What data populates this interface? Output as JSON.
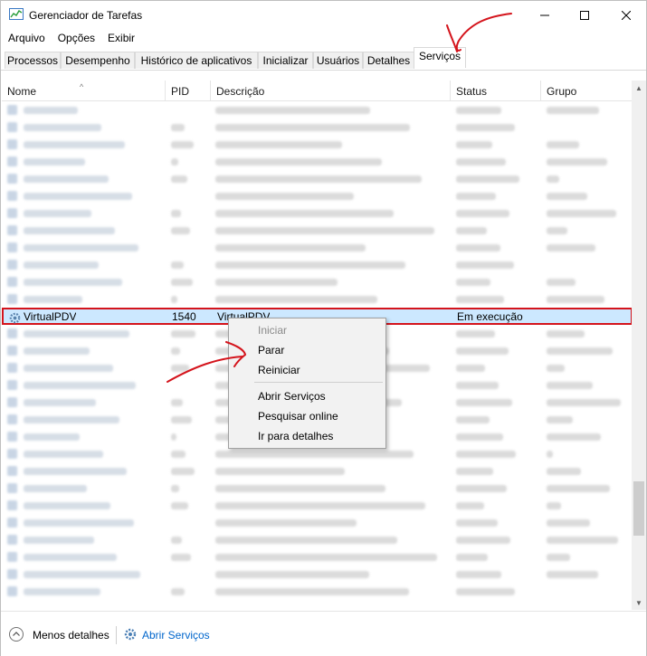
{
  "window": {
    "title": "Gerenciador de Tarefas"
  },
  "window_controls": {
    "minimize": "—",
    "maximize": "☐",
    "close": "✕"
  },
  "menu": [
    "Arquivo",
    "Opções",
    "Exibir"
  ],
  "tabs": [
    "Processos",
    "Desempenho",
    "Histórico de aplicativos",
    "Inicializar",
    "Usuários",
    "Detalhes",
    "Serviços"
  ],
  "active_tab": "Serviços",
  "columns": {
    "name": "Nome",
    "pid": "PID",
    "description": "Descrição",
    "status": "Status",
    "group": "Grupo"
  },
  "selected_row": {
    "name": "VirtualPDV",
    "pid": "1540",
    "description": "VirtualPDV",
    "status": "Em execução"
  },
  "context_menu": {
    "start": "Iniciar",
    "stop": "Parar",
    "restart": "Reiniciar",
    "open_services": "Abrir Serviços",
    "search_online": "Pesquisar online",
    "go_to_details": "Ir para detalhes"
  },
  "footer": {
    "less_details": "Menos detalhes",
    "open_services": "Abrir Serviços"
  },
  "colors": {
    "accent_link": "#0066cc",
    "selection": "#cce8ff",
    "annotation": "#d4141c"
  }
}
